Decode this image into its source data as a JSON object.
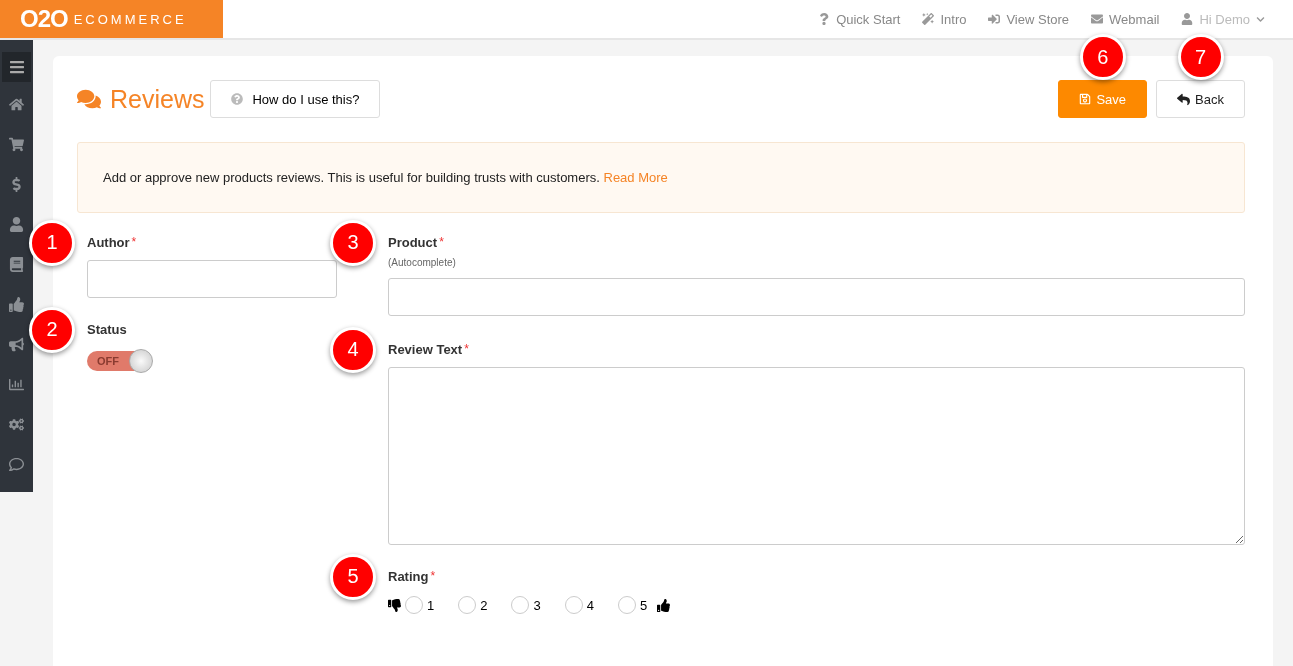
{
  "brand": {
    "logo": "O2O",
    "name": "ECOMMERCE"
  },
  "top_nav": [
    {
      "label": "Quick Start",
      "dropdown": false
    },
    {
      "label": "Intro",
      "dropdown": false
    },
    {
      "label": "View Store",
      "dropdown": false
    },
    {
      "label": "Webmail",
      "dropdown": false
    },
    {
      "label": "Hi Demo",
      "dropdown": true
    }
  ],
  "page": {
    "title": "Reviews",
    "help_button": "How do I use this?",
    "buttons": [
      {
        "kind": "primary",
        "label": "Save",
        "callout": "6"
      },
      {
        "kind": "default",
        "label": "Back",
        "callout": "7"
      }
    ]
  },
  "info": {
    "text": "Add or approve new products reviews. This is useful for building trusts with customers.",
    "link": "Read More"
  },
  "author": {
    "label": "Author",
    "asterisk": "*",
    "callout": "1"
  },
  "status": {
    "label": "Status",
    "callout": "2",
    "toggle_text": "OFF",
    "on": false
  },
  "product": {
    "label": "Product",
    "asterisk": "*",
    "hint": "(Autocomplete)",
    "callout": "3"
  },
  "review_text": {
    "label": "Review Text",
    "asterisk": "*",
    "callout": "4"
  },
  "rating": {
    "label": "Rating",
    "asterisk": "*",
    "callout": "5",
    "options": [
      {
        "label": "1",
        "selected": false
      },
      {
        "label": "2",
        "selected": false
      },
      {
        "label": "3",
        "selected": false
      },
      {
        "label": "4",
        "selected": false
      },
      {
        "label": "5",
        "selected": false
      }
    ]
  }
}
